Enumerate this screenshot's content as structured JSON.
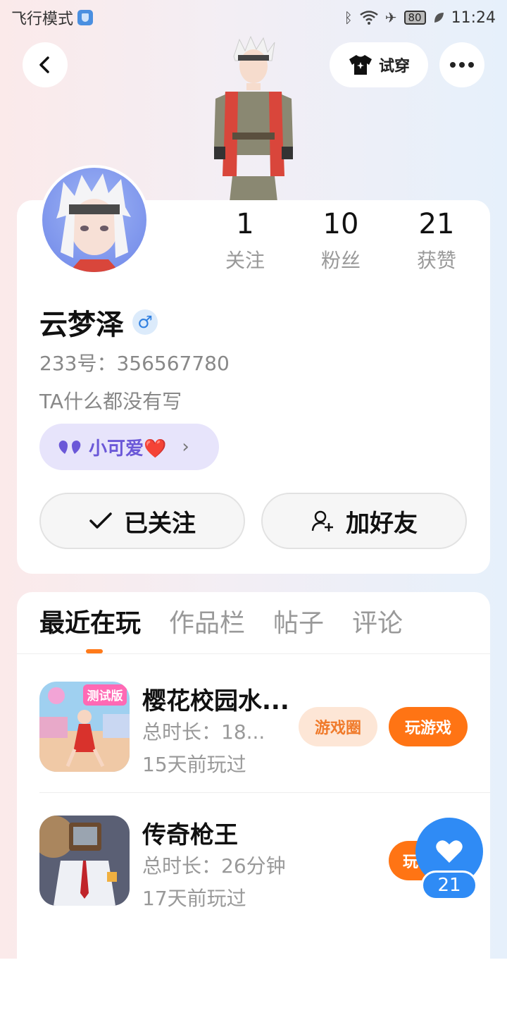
{
  "status_bar": {
    "mode": "飞行模式",
    "battery": "80",
    "time": "11:24"
  },
  "header": {
    "tryon_label": "试穿"
  },
  "profile": {
    "stats": [
      {
        "value": "1",
        "label": "关注"
      },
      {
        "value": "10",
        "label": "粉丝"
      },
      {
        "value": "21",
        "label": "获赞"
      }
    ],
    "name": "云梦泽",
    "gender_symbol": "♂",
    "uid": "233号：356567780",
    "bio": "TA什么都没有写",
    "tag": "小可爱❤️",
    "follow_label": "已关注",
    "add_friend_label": "加好友"
  },
  "tabs": [
    {
      "label": "最近在玩"
    },
    {
      "label": "作品栏"
    },
    {
      "label": "帖子"
    },
    {
      "label": "评论"
    }
  ],
  "games": [
    {
      "name": "樱花校园水...",
      "badge": "测试版",
      "duration": "总时长：18...",
      "last_played": "15天前玩过",
      "circle_label": "游戏圈",
      "play_label": "玩游戏"
    },
    {
      "name": "传奇枪王",
      "duration": "总时长：26分钟",
      "last_played": "17天前玩过",
      "play_label": "玩"
    }
  ],
  "like": {
    "count": "21"
  },
  "colors": {
    "accent": "#ff7414",
    "like_blue": "#2f8bf5",
    "tag_purple": "#6b58d8"
  }
}
